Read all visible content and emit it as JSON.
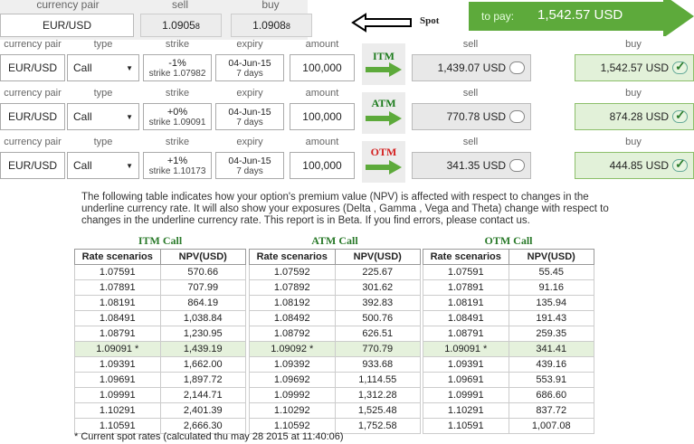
{
  "top": {
    "pair_header": "currency pair",
    "sell_header": "sell",
    "buy_header": "buy",
    "pair": "EUR/USD",
    "sell_main": "1.0905",
    "sell_small": "8",
    "buy_main": "1.0908",
    "buy_small": "8",
    "spot_label": "Spot",
    "to_pay_label": "to pay:",
    "to_pay_value": "1,542.57 USD"
  },
  "col_headers": {
    "pair": "currency pair",
    "type": "type",
    "strike": "strike",
    "expiry": "expiry",
    "amount": "amount",
    "sell": "sell",
    "buy": "buy"
  },
  "rows": [
    {
      "label": "ITM",
      "label_color": "#1a7a1a",
      "pair": "EUR/USD",
      "type": "Call",
      "strike_pct": "-1%",
      "strike": "strike 1.07982",
      "expiry_date": "04-Jun-15",
      "expiry_days": "7 days",
      "amount": "100,000",
      "sell": "1,439.07 USD",
      "buy": "1,542.57 USD"
    },
    {
      "label": "ATM",
      "label_color": "#1a7a1a",
      "pair": "EUR/USD",
      "type": "Call",
      "strike_pct": "+0%",
      "strike": "strike 1.09091",
      "expiry_date": "04-Jun-15",
      "expiry_days": "7 days",
      "amount": "100,000",
      "sell": "770.78 USD",
      "buy": "874.28 USD"
    },
    {
      "label": "OTM",
      "label_color": "#d42020",
      "pair": "EUR/USD",
      "type": "Call",
      "strike_pct": "+1%",
      "strike": "strike 1.10173",
      "expiry_date": "04-Jun-15",
      "expiry_days": "7 days",
      "amount": "100,000",
      "sell": "341.35 USD",
      "buy": "444.85 USD"
    }
  ],
  "description": "The following table indicates how your option's premium value (NPV) is affected with respect to changes in the underline currency rate. It will also show your exposures (Delta , Gamma , Vega and Theta) change with respect to changes in the underline currency rate. This report is in Beta. If you find errors, please contact us.",
  "tables": [
    {
      "title": "ITM Call",
      "headers": [
        "Rate scenarios",
        "NPV(USD)"
      ],
      "rows": [
        [
          "1.07591",
          "570.66"
        ],
        [
          "1.07891",
          "707.99"
        ],
        [
          "1.08191",
          "864.19"
        ],
        [
          "1.08491",
          "1,038.84"
        ],
        [
          "1.08791",
          "1,230.95"
        ],
        [
          "1.09091 *",
          "1,439.19"
        ],
        [
          "1.09391",
          "1,662.00"
        ],
        [
          "1.09691",
          "1,897.72"
        ],
        [
          "1.09991",
          "2,144.71"
        ],
        [
          "1.10291",
          "2,401.39"
        ],
        [
          "1.10591",
          "2,666.30"
        ]
      ]
    },
    {
      "title": "ATM Call",
      "headers": [
        "Rate scenarios",
        "NPV(USD)"
      ],
      "rows": [
        [
          "1.07592",
          "225.67"
        ],
        [
          "1.07892",
          "301.62"
        ],
        [
          "1.08192",
          "392.83"
        ],
        [
          "1.08492",
          "500.76"
        ],
        [
          "1.08792",
          "626.51"
        ],
        [
          "1.09092 *",
          "770.79"
        ],
        [
          "1.09392",
          "933.68"
        ],
        [
          "1.09692",
          "1,114.55"
        ],
        [
          "1.09992",
          "1,312.28"
        ],
        [
          "1.10292",
          "1,525.48"
        ],
        [
          "1.10592",
          "1,752.58"
        ]
      ]
    },
    {
      "title": "OTM Call",
      "headers": [
        "Rate scenarios",
        "NPV(USD)"
      ],
      "rows": [
        [
          "1.07591",
          "55.45"
        ],
        [
          "1.07891",
          "91.16"
        ],
        [
          "1.08191",
          "135.94"
        ],
        [
          "1.08491",
          "191.43"
        ],
        [
          "1.08791",
          "259.35"
        ],
        [
          "1.09091 *",
          "341.41"
        ],
        [
          "1.09391",
          "439.16"
        ],
        [
          "1.09691",
          "553.91"
        ],
        [
          "1.09991",
          "686.60"
        ],
        [
          "1.10291",
          "837.72"
        ],
        [
          "1.10591",
          "1,007.08"
        ]
      ]
    }
  ],
  "footnote": "* Current spot rates (calculated thu may 28 2015 at 11:40:06)"
}
